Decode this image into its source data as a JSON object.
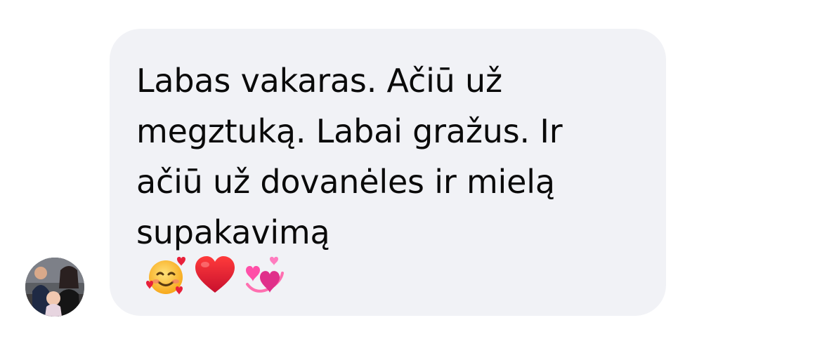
{
  "conversation": {
    "incoming_message": {
      "text": "Labas vakaras. Ačiū už megztuką. Labai gražus. Ir ačiū už dovanėles ir mielą supakavimą",
      "emojis": [
        "smiling-face-with-hearts",
        "red-heart",
        "revolving-hearts"
      ]
    },
    "sender": {
      "avatar": "group-photo-avatar"
    }
  },
  "colors": {
    "bubble_background": "#f1f2f6",
    "text": "#0a0a0a",
    "page_background": "#ffffff"
  }
}
